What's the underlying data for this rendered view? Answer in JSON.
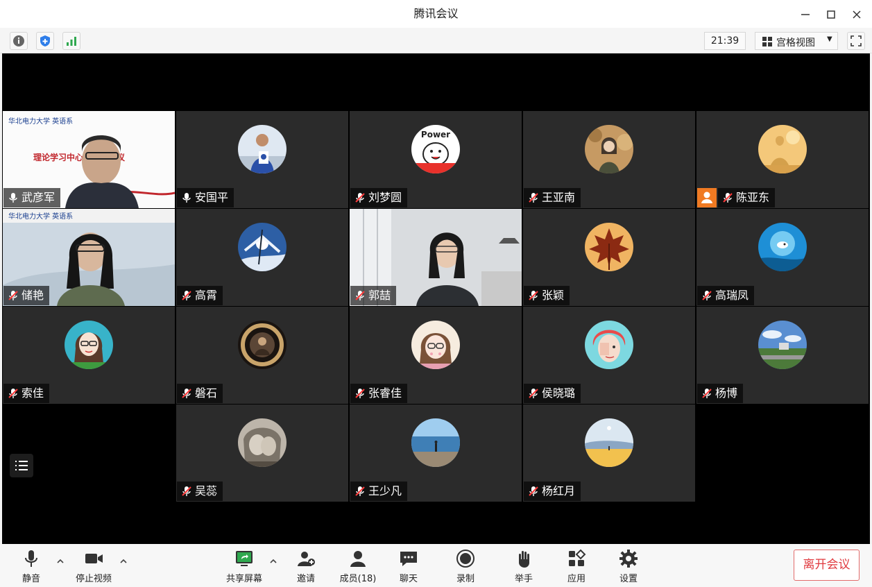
{
  "window": {
    "title": "腾讯会议"
  },
  "infobar": {
    "time": "21:39",
    "view_mode": "宫格视图"
  },
  "slide": {
    "logo_text": "华北电力大学 英语系",
    "title_text": "理论学习中心组学习会议"
  },
  "participants": [
    {
      "name": "武彦军",
      "muted": false,
      "video": true
    },
    {
      "name": "安国平",
      "muted": false,
      "video": false,
      "avatar_icon": "person-medal-avatar"
    },
    {
      "name": "刘梦圆",
      "muted": true,
      "video": false,
      "avatar_icon": "power-cartoon-avatar"
    },
    {
      "name": "王亚南",
      "muted": true,
      "video": false,
      "avatar_icon": "woman-autumn-avatar"
    },
    {
      "name": "陈亚东",
      "muted": true,
      "video": false,
      "host": true,
      "avatar_icon": "silhouette-sunset-avatar"
    },
    {
      "name": "储艳",
      "muted": true,
      "video": true
    },
    {
      "name": "高霄",
      "muted": true,
      "video": false,
      "avatar_icon": "snowy-tree-avatar"
    },
    {
      "name": "郭喆",
      "muted": true,
      "video": true
    },
    {
      "name": "张颖",
      "muted": true,
      "video": false,
      "avatar_icon": "maple-leaf-avatar"
    },
    {
      "name": "高瑞凤",
      "muted": true,
      "video": false,
      "avatar_icon": "fish-bowl-avatar"
    },
    {
      "name": "索佳",
      "muted": true,
      "video": false,
      "avatar_icon": "cartoon-woman-glasses-avatar"
    },
    {
      "name": "磐石",
      "muted": true,
      "video": false,
      "avatar_icon": "beer-logo-avatar"
    },
    {
      "name": "张睿佳",
      "muted": true,
      "video": false,
      "avatar_icon": "anime-girl-avatar"
    },
    {
      "name": "侯晓璐",
      "muted": true,
      "video": false,
      "avatar_icon": "red-hair-avatar"
    },
    {
      "name": "杨博",
      "muted": true,
      "video": false,
      "avatar_icon": "landscape-avatar"
    },
    {
      "name": "吴蕊",
      "muted": true,
      "video": false,
      "avatar_icon": "sketch-portrait-avatar"
    },
    {
      "name": "王少凡",
      "muted": true,
      "video": false,
      "avatar_icon": "beach-person-avatar"
    },
    {
      "name": "杨红月",
      "muted": true,
      "video": false,
      "avatar_icon": "desert-moon-avatar"
    }
  ],
  "toolbar": {
    "mute": "静音",
    "stop_video": "停止视频",
    "share_screen": "共享屏幕",
    "invite": "邀请",
    "members": "成员(18)",
    "chat": "聊天",
    "record": "录制",
    "raise_hand": "举手",
    "apps": "应用",
    "settings": "设置",
    "leave": "离开会议"
  },
  "colors": {
    "stage_bg": "#000000",
    "tile_bg": "#2b2b2b",
    "host_badge": "#f07a22",
    "leave_red": "#e0393e",
    "share_green": "#2fa84f"
  }
}
